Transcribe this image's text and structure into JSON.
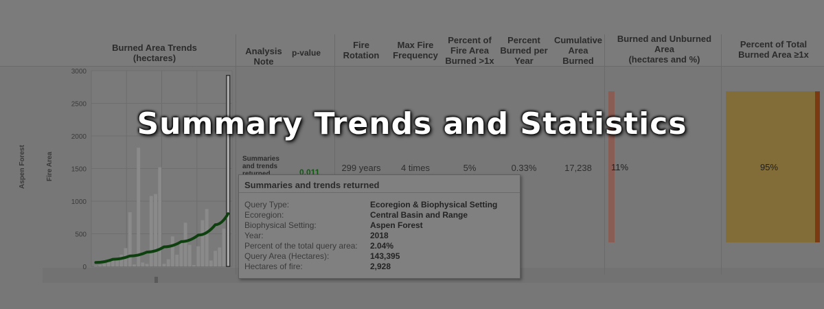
{
  "headers": {
    "burned_trends": "Burned Area Trends\n(hectares)",
    "analysis_note": "Analysis\nNote",
    "pvalue": "p-value",
    "fire_rotation": "Fire\nRotation",
    "max_fire_frequency": "Max Fire\nFrequency",
    "pct_fire_area": "Percent of\nFire Area\nBurned >1x",
    "pct_burned_year": "Percent\nBurned per\nYear",
    "cumulative": "Cumulative\nArea\nBurned",
    "burned_unburned": "Burned and Unburned\nArea\n(hectares and %)",
    "pct_total": "Percent of Total\nBurned Area ≥1x"
  },
  "row_labels": {
    "ecotype": "Aspen Forest",
    "metric": "Fire Area"
  },
  "row": {
    "note": "Summaries\nand trends\nreturned",
    "pvalue": "0.011",
    "fire_rotation": "299 years",
    "max_fire_frequency": "4 times",
    "pct_fire_area": "5%",
    "pct_burned_year": "0.33%",
    "cumulative": "17,238",
    "burned_pct": "11%",
    "total_pct": "95%"
  },
  "tooltip": {
    "title": "Summaries and trends returned",
    "rows": [
      {
        "key": "Query Type:",
        "value": "Ecoregion & Biophysical Setting"
      },
      {
        "key": "Ecoregion:",
        "value": "Central Basin and Range"
      },
      {
        "key": "Biophysical Setting:",
        "value": "Aspen Forest"
      },
      {
        "key": "Year:",
        "value": "2018"
      },
      {
        "key": "Percent of the total query area:",
        "value": "2.04%"
      },
      {
        "key": "Query Area (Hectares):",
        "value": "143,395"
      },
      {
        "key": "Hectares of fire:",
        "value": "2,928"
      }
    ]
  },
  "banner": "Summary Trends and Statistics",
  "colors": {
    "trend_line": "#0e3f0e",
    "bar": "#8a8a8a",
    "highlight_bar": "#a8a8a8"
  },
  "chart_data": {
    "type": "bar",
    "title": "Burned Area Trends\n(hectares)",
    "ylim": [
      0,
      3000
    ],
    "yticks": [
      0,
      500,
      1000,
      1500,
      2000,
      2500,
      3000
    ],
    "values": [
      10,
      20,
      40,
      70,
      90,
      120,
      180,
      280,
      830,
      30,
      1820,
      60,
      40,
      1080,
      1110,
      1520,
      40,
      110,
      460,
      180,
      370,
      670,
      330,
      20,
      310,
      710,
      880,
      90,
      240,
      290,
      580,
      2928
    ],
    "highlight_index": 31,
    "trend": {
      "x": [
        0,
        4,
        8,
        12,
        16,
        20,
        24,
        28,
        31
      ],
      "y": [
        60,
        110,
        160,
        220,
        300,
        380,
        480,
        640,
        810
      ]
    }
  }
}
